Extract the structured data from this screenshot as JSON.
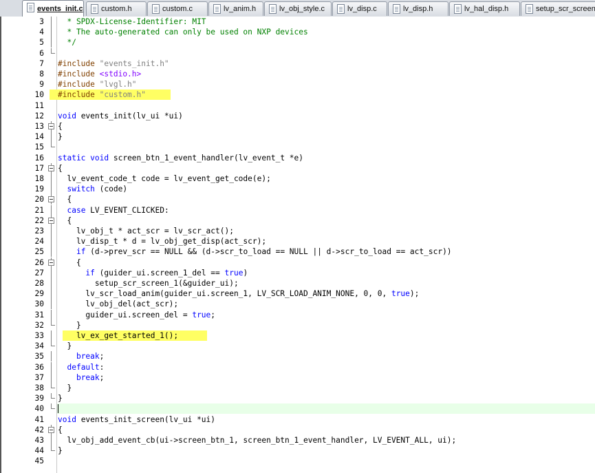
{
  "tabs": [
    {
      "label": "events_init.c",
      "active": true
    },
    {
      "label": "custom.h"
    },
    {
      "label": "custom.c"
    },
    {
      "label": "lv_anim.h"
    },
    {
      "label": "lv_obj_style.c"
    },
    {
      "label": "lv_disp.c"
    },
    {
      "label": "lv_disp.h"
    },
    {
      "label": "lv_hal_disp.h"
    },
    {
      "label": "setup_scr_screen"
    }
  ],
  "colors": {
    "keyword": "#0000ff",
    "preprocessor": "#804000",
    "string": "#808080",
    "comment": "#008000",
    "include_angle": "#8000ff",
    "highlight": "#ffff63",
    "current_line": "#e8ffe8"
  },
  "editor": {
    "highlighted_lines": [
      10,
      33
    ],
    "current_line": 40,
    "lines": [
      {
        "n": "3",
        "fold": "line",
        "code": "  * SPDX-License-Identifier: MIT"
      },
      {
        "n": "4",
        "fold": "line",
        "code": "  * The auto-generated can only be used on NXP devices"
      },
      {
        "n": "5",
        "fold": "line",
        "code": "  */"
      },
      {
        "n": "6",
        "fold": "end",
        "code": ""
      },
      {
        "n": "7",
        "fold": "",
        "code": "#include \"events_init.h\""
      },
      {
        "n": "8",
        "fold": "",
        "code": "#include <stdio.h>"
      },
      {
        "n": "9",
        "fold": "",
        "code": "#include \"lvgl.h\""
      },
      {
        "n": "10",
        "fold": "",
        "code": "#include \"custom.h\""
      },
      {
        "n": "11",
        "fold": "",
        "code": ""
      },
      {
        "n": "12",
        "fold": "",
        "code": "void events_init(lv_ui *ui)"
      },
      {
        "n": "13",
        "fold": "box",
        "code": "{"
      },
      {
        "n": "14",
        "fold": "line",
        "code": "}"
      },
      {
        "n": "15",
        "fold": "end",
        "code": ""
      },
      {
        "n": "16",
        "fold": "",
        "code": "static void screen_btn_1_event_handler(lv_event_t *e)"
      },
      {
        "n": "17",
        "fold": "box",
        "code": "{"
      },
      {
        "n": "18",
        "fold": "line",
        "code": "  lv_event_code_t code = lv_event_get_code(e);"
      },
      {
        "n": "19",
        "fold": "line",
        "code": "  switch (code)"
      },
      {
        "n": "20",
        "fold": "box",
        "code": "  {"
      },
      {
        "n": "21",
        "fold": "line",
        "code": "  case LV_EVENT_CLICKED:"
      },
      {
        "n": "22",
        "fold": "box",
        "code": "  {"
      },
      {
        "n": "23",
        "fold": "line",
        "code": "    lv_obj_t * act_scr = lv_scr_act();"
      },
      {
        "n": "24",
        "fold": "line",
        "code": "    lv_disp_t * d = lv_obj_get_disp(act_scr);"
      },
      {
        "n": "25",
        "fold": "line",
        "code": "    if (d->prev_scr == NULL && (d->scr_to_load == NULL || d->scr_to_load == act_scr))"
      },
      {
        "n": "26",
        "fold": "box",
        "code": "    {"
      },
      {
        "n": "27",
        "fold": "line",
        "code": "      if (guider_ui.screen_1_del == true)"
      },
      {
        "n": "28",
        "fold": "line",
        "code": "        setup_scr_screen_1(&guider_ui);"
      },
      {
        "n": "29",
        "fold": "line",
        "code": "      lv_scr_load_anim(guider_ui.screen_1, LV_SCR_LOAD_ANIM_NONE, 0, 0, true);"
      },
      {
        "n": "30",
        "fold": "line",
        "code": "      lv_obj_del(act_scr);"
      },
      {
        "n": "31",
        "fold": "line",
        "code": "      guider_ui.screen_del = true;"
      },
      {
        "n": "32",
        "fold": "end",
        "code": "    }"
      },
      {
        "n": "33",
        "fold": "line",
        "code": "    lv_ex_get_started_1();"
      },
      {
        "n": "34",
        "fold": "end",
        "code": "  }"
      },
      {
        "n": "35",
        "fold": "line",
        "code": "    break;"
      },
      {
        "n": "36",
        "fold": "line",
        "code": "  default:"
      },
      {
        "n": "37",
        "fold": "line",
        "code": "    break;"
      },
      {
        "n": "38",
        "fold": "end",
        "code": "  }"
      },
      {
        "n": "39",
        "fold": "end",
        "code": "}"
      },
      {
        "n": "40",
        "fold": "end",
        "code": ""
      },
      {
        "n": "41",
        "fold": "",
        "code": "void events_init_screen(lv_ui *ui)"
      },
      {
        "n": "42",
        "fold": "box",
        "code": "{"
      },
      {
        "n": "43",
        "fold": "line",
        "code": "  lv_obj_add_event_cb(ui->screen_btn_1, screen_btn_1_event_handler, LV_EVENT_ALL, ui);"
      },
      {
        "n": "44",
        "fold": "end",
        "code": "}"
      },
      {
        "n": "45",
        "fold": "",
        "code": ""
      }
    ]
  }
}
